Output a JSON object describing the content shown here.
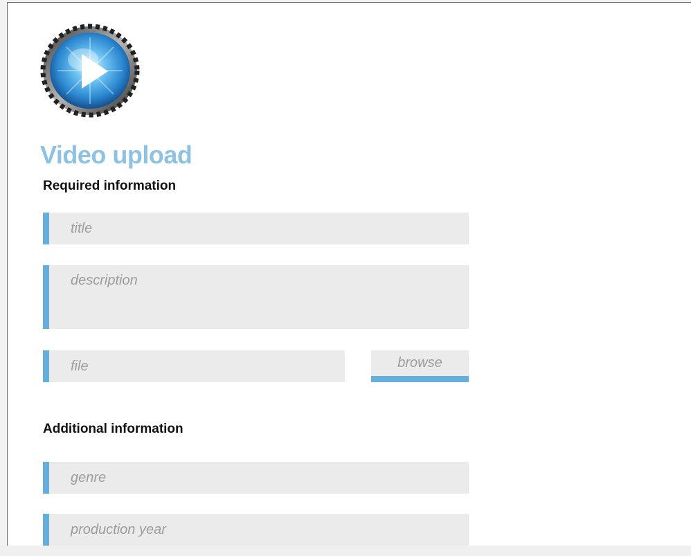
{
  "page": {
    "title": "Video upload"
  },
  "logo": {
    "icon": "play-film-reel-icon",
    "accent_color": "#3d9ee0"
  },
  "required_section": {
    "heading": "Required information",
    "title_placeholder": "title",
    "description_placeholder": "description",
    "file_placeholder": "file",
    "browse_label": "browse"
  },
  "additional_section": {
    "heading": "Additional information",
    "genre_placeholder": "genre",
    "production_year_placeholder": "production year"
  },
  "colors": {
    "accent": "#66aedb",
    "title": "#8ec2e3",
    "field_background": "#ebebeb",
    "placeholder": "#9c9c9c"
  }
}
